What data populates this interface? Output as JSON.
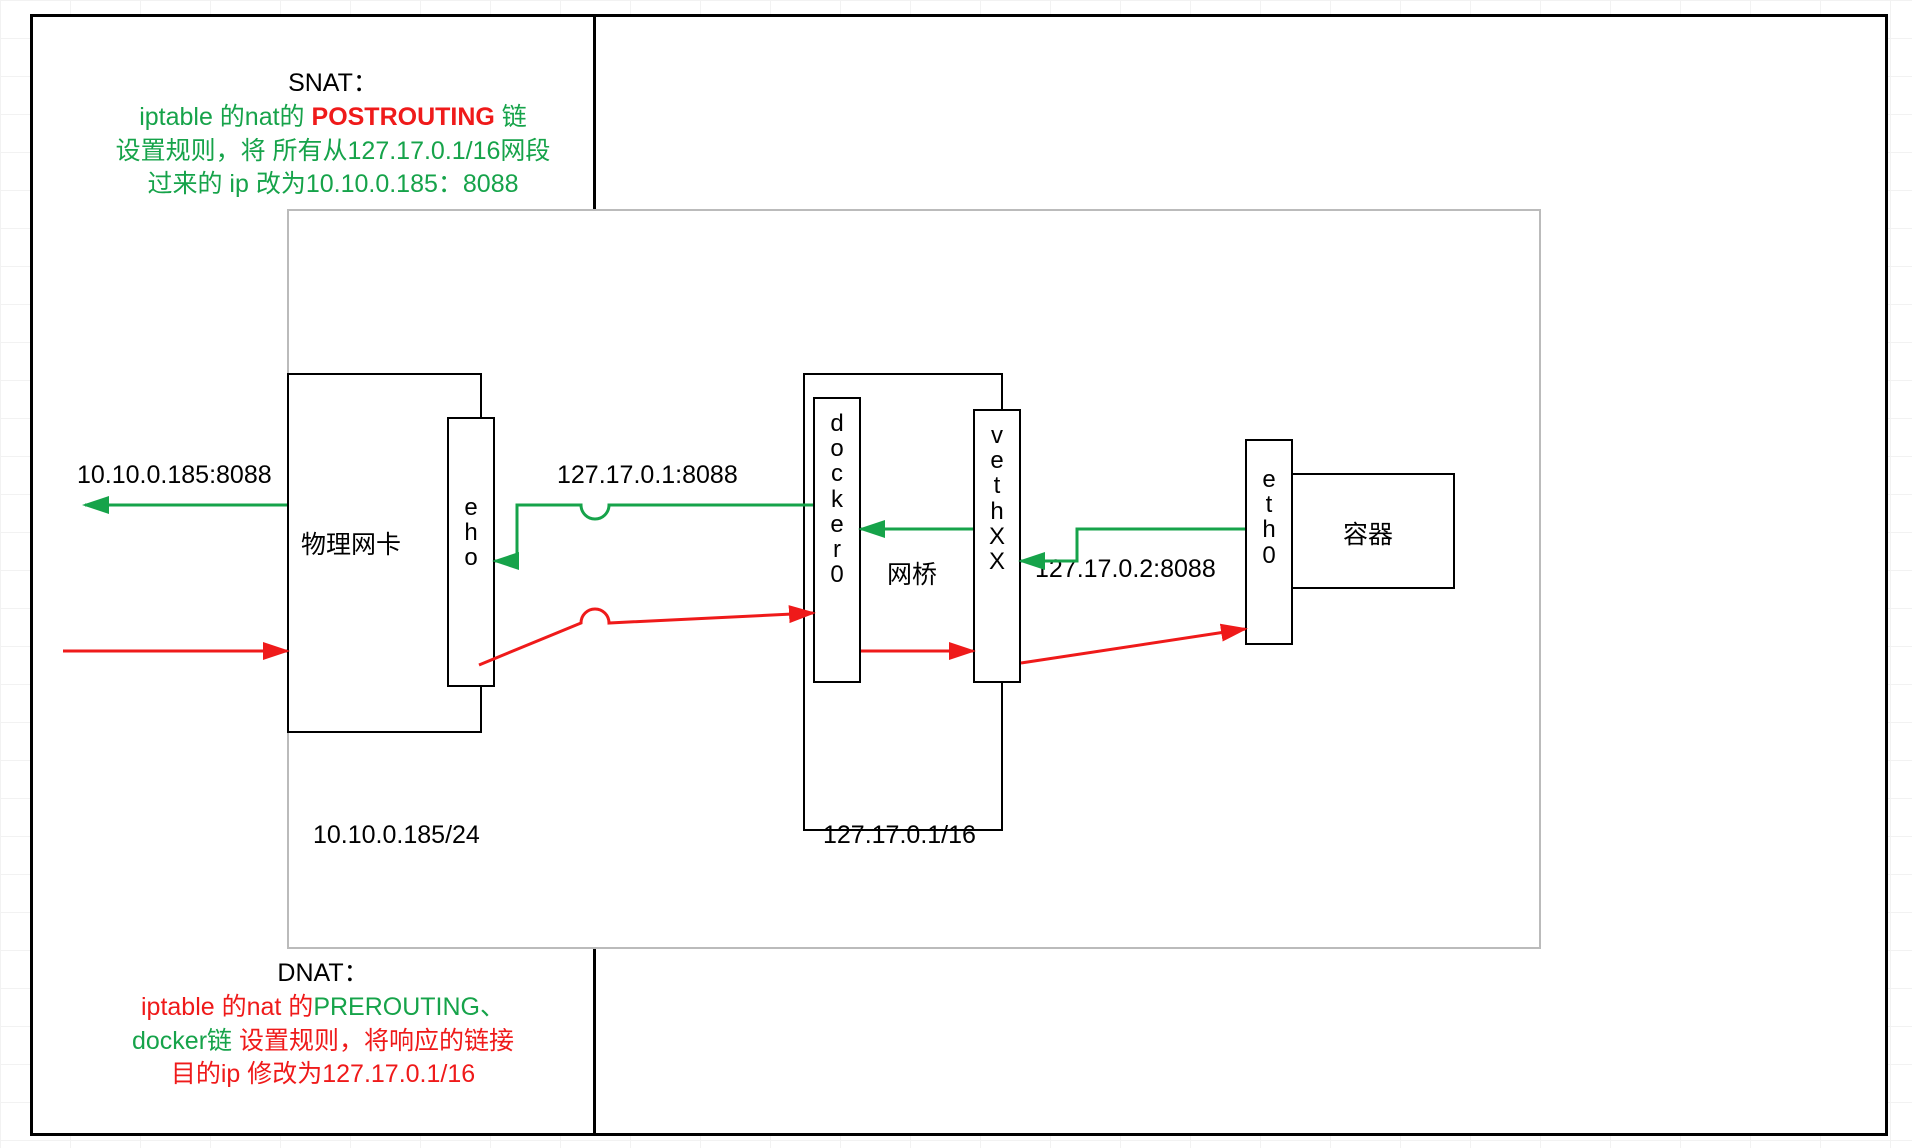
{
  "snat": {
    "title": "SNAT：",
    "line1a": "iptable 的nat的 ",
    "line1b": "POSTROUTING",
    "line1c": " 链",
    "line2": "设置规则，将 所有从127.17.0.1/16网段",
    "line3": "过来的 ip 改为10.10.0.185：8088"
  },
  "dnat": {
    "title": "DNAT：",
    "line1a": "iptable 的nat 的",
    "line1b": "PREROUTING、",
    "line2a": "docker链",
    "line2b": " 设置规则，将响应的链接",
    "line3": "目的ip 修改为127.17.0.1/16"
  },
  "ip_left_upper": "10.10.0.185:8088",
  "ip_mid": "127.17.0.1:8088",
  "ip_right": "127.17.0.2:8088",
  "phys_nic_label": "物理网卡",
  "eho_v": "eho",
  "bridge_label": "网桥",
  "docker0_v": "docker0",
  "vethXX_v": "vethXX",
  "eth0_v": "eth0",
  "container_label": "容器",
  "nic_subnet": "10.10.0.185/24",
  "bridge_subnet": "127.17.0.1/16",
  "colors": {
    "green": "#16a34a",
    "red": "#ef1a1a"
  }
}
